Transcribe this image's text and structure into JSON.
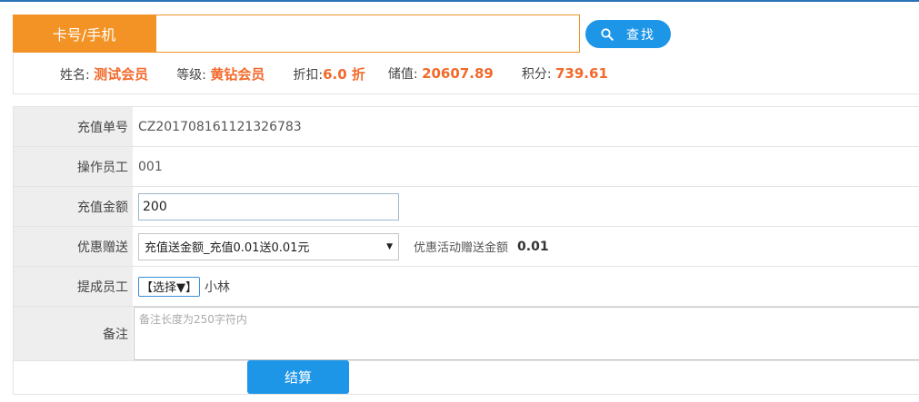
{
  "search": {
    "label": "卡号/手机",
    "value": "",
    "button_label": "查找",
    "button_icon": "search-icon"
  },
  "member": {
    "name_label": "姓名:",
    "name": "测试会员",
    "level_label": "等级:",
    "level": "黄钻会员",
    "discount_label": "折扣:",
    "discount": "6.0 折",
    "balance_label": "储值:",
    "balance": "20607.89",
    "points_label": "积分:",
    "points": "739.61"
  },
  "form": {
    "order_no_label": "充值单号",
    "order_no": "CZ201708161121326783",
    "operator_label": "操作员工",
    "operator": "001",
    "amount_label": "充值金额",
    "amount": "200",
    "promo_label": "优惠赠送",
    "promo_selected": "充值送金额_充值0.01送0.01元",
    "gift_label": "优惠活动赠送金额",
    "gift_value": "0.01",
    "commission_label": "提成员工",
    "commission_select": "【选择▼】",
    "commission_staff": "小林",
    "remark_label": "备注",
    "remark_placeholder": "备注长度为250字符内"
  },
  "actions": {
    "settle_label": "结算"
  },
  "colors": {
    "accent_orange": "#f39325",
    "value_red": "#f26a2c",
    "button_blue": "#1e96e8"
  }
}
